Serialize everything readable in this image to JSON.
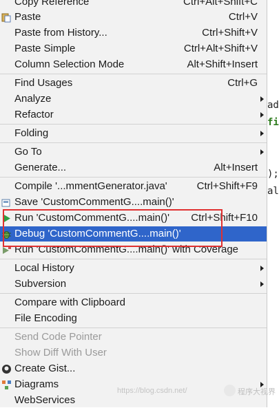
{
  "menu": {
    "copy_reference": {
      "label": "Copy Reference",
      "shortcut": "Ctrl+Alt+Shift+C"
    },
    "paste": {
      "label": "Paste",
      "shortcut": "Ctrl+V"
    },
    "paste_history": {
      "label": "Paste from History...",
      "shortcut": "Ctrl+Shift+V"
    },
    "paste_simple": {
      "label": "Paste Simple",
      "shortcut": "Ctrl+Alt+Shift+V"
    },
    "column_selection": {
      "label": "Column Selection Mode",
      "shortcut": "Alt+Shift+Insert"
    },
    "find_usages": {
      "label": "Find Usages",
      "shortcut": "Ctrl+G"
    },
    "analyze": {
      "label": "Analyze"
    },
    "refactor": {
      "label": "Refactor"
    },
    "folding": {
      "label": "Folding"
    },
    "go_to": {
      "label": "Go To"
    },
    "generate": {
      "label": "Generate...",
      "shortcut": "Alt+Insert"
    },
    "compile": {
      "label": "Compile '...mmentGenerator.java'",
      "shortcut": "Ctrl+Shift+F9"
    },
    "save": {
      "label": "Save 'CustomCommentG....main()'"
    },
    "run": {
      "label": "Run 'CustomCommentG....main()'",
      "shortcut": "Ctrl+Shift+F10"
    },
    "debug": {
      "label": "Debug 'CustomCommentG....main()'"
    },
    "run_coverage": {
      "label": "Run 'CustomCommentG....main()' with Coverage"
    },
    "local_history": {
      "label": "Local History"
    },
    "subversion": {
      "label": "Subversion"
    },
    "compare_clipboard": {
      "label": "Compare with Clipboard"
    },
    "file_encoding": {
      "label": "File Encoding"
    },
    "send_code_pointer": {
      "label": "Send Code Pointer"
    },
    "show_diff_user": {
      "label": "Show Diff With User"
    },
    "create_gist": {
      "label": "Create Gist..."
    },
    "diagrams": {
      "label": "Diagrams"
    },
    "webservices": {
      "label": "WebServices"
    }
  },
  "editor": {
    "line1": "ad",
    "line2": "fi",
    "line3": ");",
    "line4": "al"
  },
  "watermark": {
    "url": "https://blog.csdn.net/",
    "account": "程序大视界"
  },
  "colors": {
    "selection": "#2f65ca",
    "highlight_box": "#e03030",
    "run_icon": "#2ea043"
  }
}
